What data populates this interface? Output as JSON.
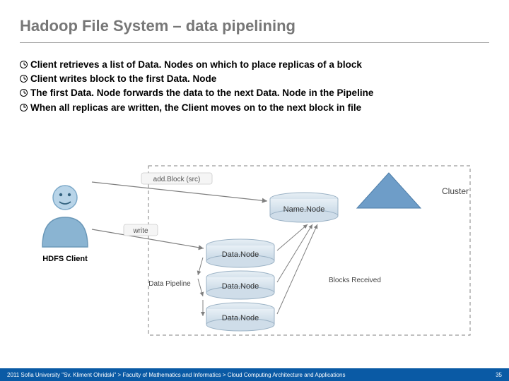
{
  "title": "Hadoop File System – data pipelining",
  "bullets": [
    "Client retrieves a list of Data. Nodes on which to place replicas of a block",
    "Client writes block to the first Data. Node",
    "The first Data. Node forwards the data to the next Data. Node in the Pipeline",
    "When all replicas are written, the Client moves on to the next block in file"
  ],
  "diagram": {
    "labels": {
      "hdfs_client": "HDFS Client",
      "add_block": "add.Block (src)",
      "write": "write",
      "cluster": "Cluster",
      "name_node": "Name.Node",
      "data_node": "Data.Node",
      "data_pipeline": "Data\nPipeline",
      "blocks_received": "Blocks\nReceived"
    }
  },
  "footer": {
    "text": "2011 Sofia University \"Sv. Kliment Ohridski\" > Faculty of Mathematics and Informatics > Cloud Computing Architecture and Applications",
    "page": "35"
  }
}
